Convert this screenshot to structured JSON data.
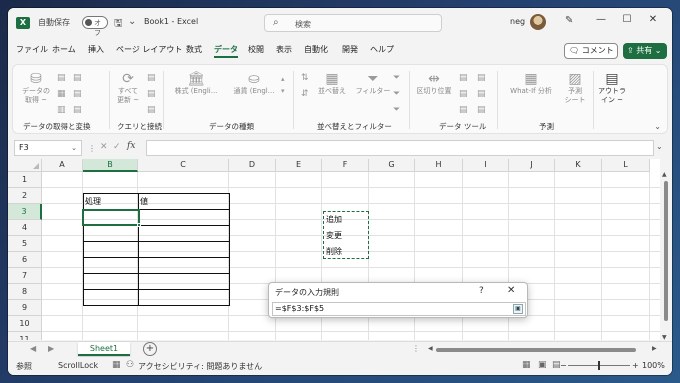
{
  "titlebar": {
    "app_icon": "X",
    "autosave_label": "自動保存",
    "autosave_state": "オフ",
    "doc_title": "Book1 - Excel",
    "search_placeholder": "検索",
    "user_name": "neg"
  },
  "ribbon_tabs": [
    "ファイル",
    "ホーム",
    "挿入",
    "ページ レイアウト",
    "数式",
    "データ",
    "校閲",
    "表示",
    "自動化",
    "開発",
    "ヘルプ"
  ],
  "active_tab": "データ",
  "comment_button": "コメント",
  "share_button": "共有",
  "ribbon": {
    "groups": [
      "データの取得と変換",
      "クエリと接続",
      "データの種類",
      "並べ替えとフィルター",
      "データ ツール",
      "予測"
    ],
    "get_data": "データの\n取得 ~",
    "refresh_all": "すべて\n更新 ~",
    "stocks": "株式 (Engli...",
    "currency": "通貨 (Engl...",
    "sort": "並べ替え",
    "filter": "フィルター",
    "flash_fill": "区切り位置",
    "whatif": "What-If 分析",
    "forecast_sheet": "予測\nシート",
    "outline": "アウトラ\nイン ~"
  },
  "formula_bar": {
    "name_box": "F3",
    "fx": "fx",
    "formula": ""
  },
  "columns": [
    "A",
    "B",
    "C",
    "D",
    "E",
    "F",
    "G",
    "H",
    "I",
    "J",
    "K",
    "L"
  ],
  "rows": [
    "1",
    "2",
    "3",
    "4",
    "5",
    "6",
    "7",
    "8",
    "9",
    "10",
    "11"
  ],
  "cells": {
    "B2": "処理",
    "C2": "値",
    "F3": "追加",
    "F4": "変更",
    "F5": "削除"
  },
  "dialog": {
    "title": "データの入力規則",
    "help": "?",
    "close": "✕",
    "value": "=$F$3:$F$5"
  },
  "sheet_tabs": [
    "Sheet1"
  ],
  "statusbar": {
    "mode": "参照",
    "scroll_lock": "ScrollLock",
    "accessibility": "アクセシビリティ: 問題ありません",
    "zoom": "100%"
  },
  "colors": {
    "accent": "#1d6f42",
    "header_selected": "#d3e8d9"
  }
}
